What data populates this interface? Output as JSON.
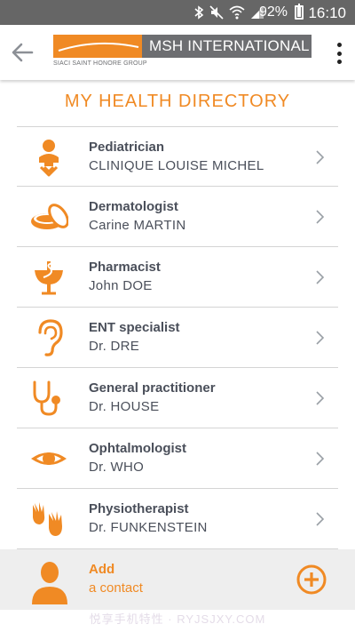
{
  "status_bar": {
    "battery_percent": "92%",
    "time": "16:10",
    "icons": [
      "bluetooth-icon",
      "mute-icon",
      "wifi-icon",
      "signal-icon",
      "battery-icon"
    ]
  },
  "header": {
    "brand_name": "MSH INTERNATIONAL",
    "brand_subtitle": "SIACI SAINT HONORE GROUP",
    "back_icon": "arrow-left-icon",
    "menu_icon": "more-vertical-icon"
  },
  "page_title": "MY HEALTH DIRECTORY",
  "contacts": [
    {
      "specialty": "Pediatrician",
      "name": "CLINIQUE LOUISE MICHEL",
      "icon": "baby-icon"
    },
    {
      "specialty": "Dermatologist",
      "name": "Carine MARTIN",
      "icon": "cream-jar-icon"
    },
    {
      "specialty": "Pharmacist",
      "name": "John DOE",
      "icon": "pharmacy-icon"
    },
    {
      "specialty": "ENT specialist",
      "name": "Dr. DRE",
      "icon": "ear-icon"
    },
    {
      "specialty": "General practitioner",
      "name": "Dr. HOUSE",
      "icon": "stethoscope-icon"
    },
    {
      "specialty": "Ophtalmologist",
      "name": "Dr. WHO",
      "icon": "eye-icon"
    },
    {
      "specialty": "Physiotherapist",
      "name": "Dr. FUNKENSTEIN",
      "icon": "hands-icon"
    }
  ],
  "add_contact": {
    "label": "Add",
    "sublabel": "a contact"
  },
  "watermark": "悦享手机特性 · RYJSJXY.COM",
  "colors": {
    "accent": "#f08a24",
    "brand_gray": "#6d6e71",
    "text": "#4a4f5a",
    "status_bar": "#666666"
  }
}
